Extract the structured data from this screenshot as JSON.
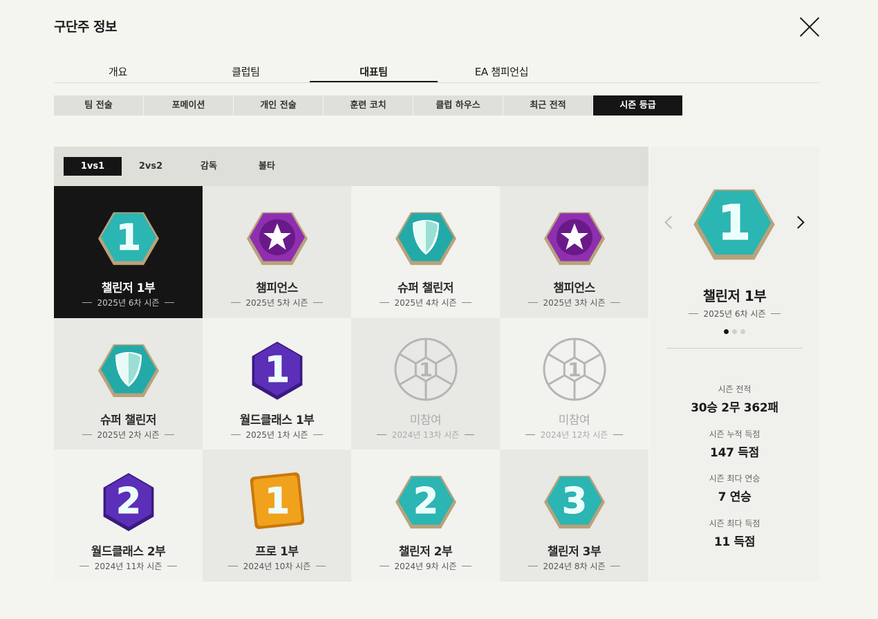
{
  "header": {
    "title": "구단주 정보"
  },
  "tabs": [
    {
      "label": "개요"
    },
    {
      "label": "클럽팀"
    },
    {
      "label": "대표팀"
    },
    {
      "label": "EA 챔피언십"
    }
  ],
  "active_tab": 2,
  "subtabs": [
    {
      "label": "팀 전술"
    },
    {
      "label": "포메이션"
    },
    {
      "label": "개인 전술"
    },
    {
      "label": "훈련 코치"
    },
    {
      "label": "클럽 하우스"
    },
    {
      "label": "최근 전적"
    },
    {
      "label": "시즌 등급"
    }
  ],
  "active_subtab": 6,
  "modes": [
    {
      "label": "1vs1"
    },
    {
      "label": "2vs2"
    },
    {
      "label": "감독"
    },
    {
      "label": "볼타"
    }
  ],
  "active_mode": 0,
  "seasons": [
    {
      "name": "챌린저 1부",
      "season": "2025년 6차 시즌",
      "badge": "challenger",
      "num": "1"
    },
    {
      "name": "챔피언스",
      "season": "2025년 5차 시즌",
      "badge": "champions",
      "num": "star"
    },
    {
      "name": "슈퍼 챌린저",
      "season": "2025년 4차 시즌",
      "badge": "super",
      "num": "shield"
    },
    {
      "name": "챔피언스",
      "season": "2025년 3차 시즌",
      "badge": "champions",
      "num": "star"
    },
    {
      "name": "슈퍼 챌린저",
      "season": "2025년 2차 시즌",
      "badge": "super",
      "num": "shield"
    },
    {
      "name": "월드클래스 1부",
      "season": "2025년 1차 시즌",
      "badge": "worldclass",
      "num": "1"
    },
    {
      "name": "미참여",
      "season": "2024년 13차 시즌",
      "badge": "none",
      "num": "1"
    },
    {
      "name": "미참여",
      "season": "2024년 12차 시즌",
      "badge": "none",
      "num": "1"
    },
    {
      "name": "월드클래스 2부",
      "season": "2024년 11차 시즌",
      "badge": "worldclass",
      "num": "2"
    },
    {
      "name": "프로 1부",
      "season": "2024년 10차 시즌",
      "badge": "pro",
      "num": "1"
    },
    {
      "name": "챌린저 2부",
      "season": "2024년 9차 시즌",
      "badge": "challenger",
      "num": "2"
    },
    {
      "name": "챌린저 3부",
      "season": "2024년 8차 시즌",
      "badge": "challenger",
      "num": "3"
    }
  ],
  "detail": {
    "name": "챌린저 1부",
    "season": "2025년 6차 시즌",
    "badge": "challenger",
    "num": "1",
    "stats": [
      {
        "label": "시즌 전적",
        "value": "30승 2무 362패"
      },
      {
        "label": "시즌 누적 득점",
        "value": "147 득점"
      },
      {
        "label": "시즌 최다 연승",
        "value": "7 연승"
      },
      {
        "label": "시즌 최다 득점",
        "value": "11 득점"
      }
    ]
  },
  "colors": {
    "challenger": "#2bb5b3",
    "champions": "#8e2fb0",
    "super": "#23aaa8",
    "worldclass": "#5b2fb8",
    "pro": "#f0a21c",
    "none": "#b5b5b5"
  }
}
